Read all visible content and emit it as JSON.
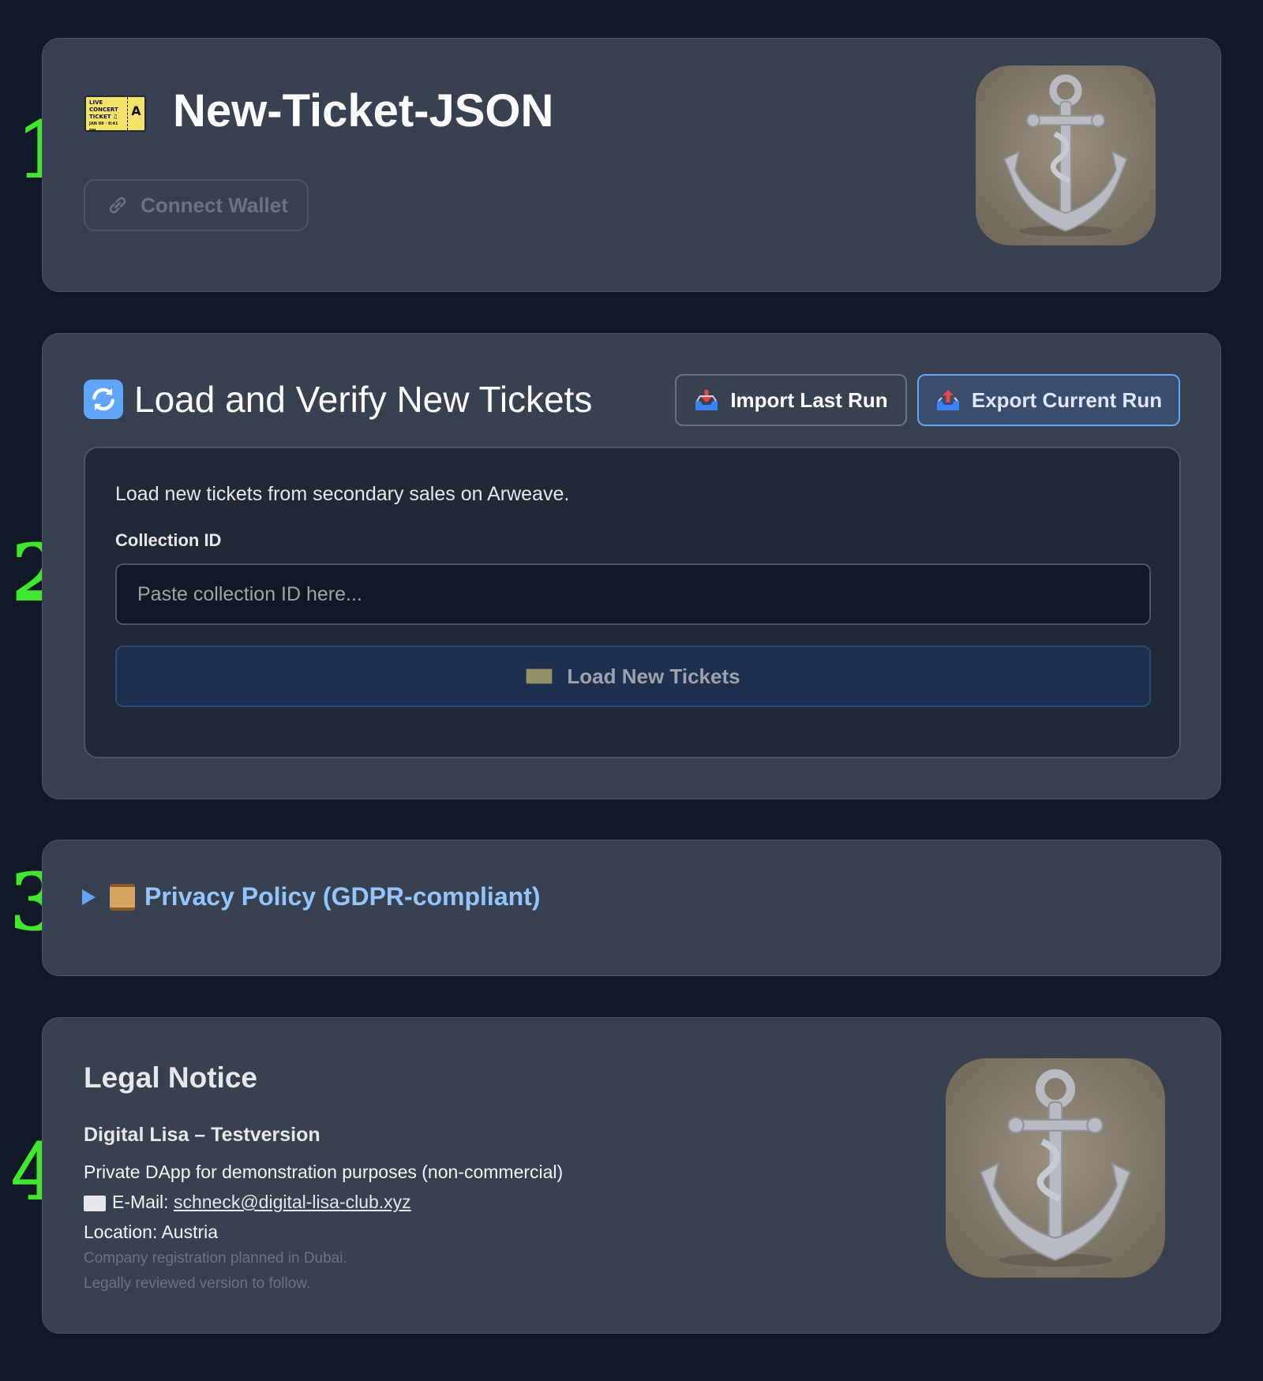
{
  "steps": [
    "1.",
    "2.",
    "3.",
    "4."
  ],
  "header": {
    "title": "New-Ticket-JSON",
    "ticket_icon": {
      "name": "ticket-icon",
      "lines": [
        "LIVE",
        "CONCERT",
        "TICKET ♫",
        "JAN 09 · 9:41 PM"
      ],
      "zone": "A",
      "zone_label": "ZONE"
    },
    "connect_wallet_label": "Connect Wallet",
    "logo_icon": "anchor-icon"
  },
  "loader": {
    "title": "Load and Verify New Tickets",
    "import_label": "Import Last Run",
    "export_label": "Export Current Run",
    "description": "Load new tickets from secondary sales on Arweave.",
    "field_label": "Collection ID",
    "input_value": "",
    "input_placeholder": "Paste collection ID here...",
    "load_button_label": "Load New Tickets"
  },
  "privacy": {
    "label": "Privacy Policy (GDPR-compliant)"
  },
  "legal": {
    "title": "Legal Notice",
    "name": "Digital Lisa – Testversion",
    "purpose": "Private DApp for demonstration purposes (non-commercial)",
    "email_label": "E-Mail: ",
    "email": "schneck@digital-lisa-club.xyz",
    "location": "Location: Austria",
    "note1": "Company registration planned in Dubai.",
    "note2": "Legally reviewed version to follow."
  },
  "colors": {
    "background": "#111827",
    "card": "#374151",
    "step_marker": "#3ee82c",
    "accent": "#60a5fa",
    "link": "#93c5fd"
  }
}
